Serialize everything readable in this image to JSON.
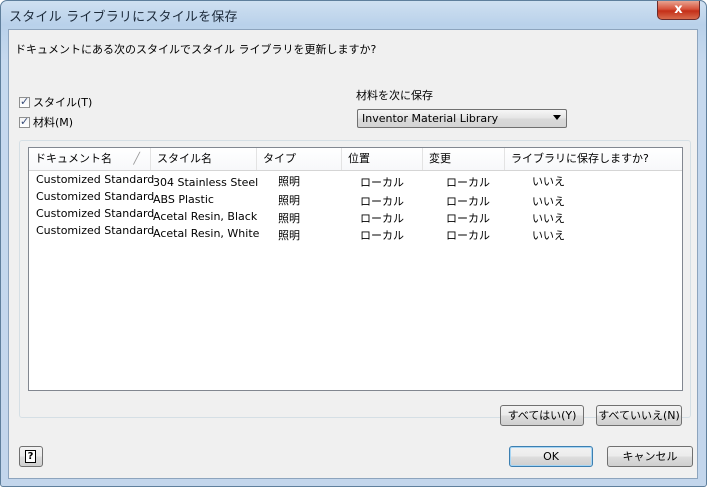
{
  "window": {
    "title": "スタイル ライブラリにスタイルを保存",
    "close_label": "x"
  },
  "question": "ドキュメントにある次のスタイルでスタイル ライブラリを更新しますか?",
  "checkboxes": {
    "style_label": "スタイル(T)",
    "style_checked": true,
    "material_label": "材料(M)",
    "material_checked": true
  },
  "save_as": {
    "label": "材料を次に保存",
    "selected": "Inventor Material Library"
  },
  "table": {
    "headers": [
      "ドキュメント名",
      "スタイル名",
      "タイプ",
      "位置",
      "変更",
      "ライブラリに保存しますか?"
    ],
    "rows": [
      [
        "Customized Standard",
        "304 Stainless Steel",
        "照明",
        "ローカル",
        "ローカル",
        "いいえ"
      ],
      [
        "Customized Standard",
        "ABS Plastic",
        "照明",
        "ローカル",
        "ローカル",
        "いいえ"
      ],
      [
        "Customized Standard",
        "Acetal Resin, Black",
        "照明",
        "ローカル",
        "ローカル",
        "いいえ"
      ],
      [
        "Customized Standard",
        "Acetal Resin, White",
        "照明",
        "ローカル",
        "ローカル",
        "いいえ"
      ]
    ]
  },
  "buttons": {
    "yes_all": "すべてはい(Y)",
    "no_all": "すべていいえ(N)",
    "ok": "OK",
    "cancel": "キャンセル",
    "help": "?"
  }
}
